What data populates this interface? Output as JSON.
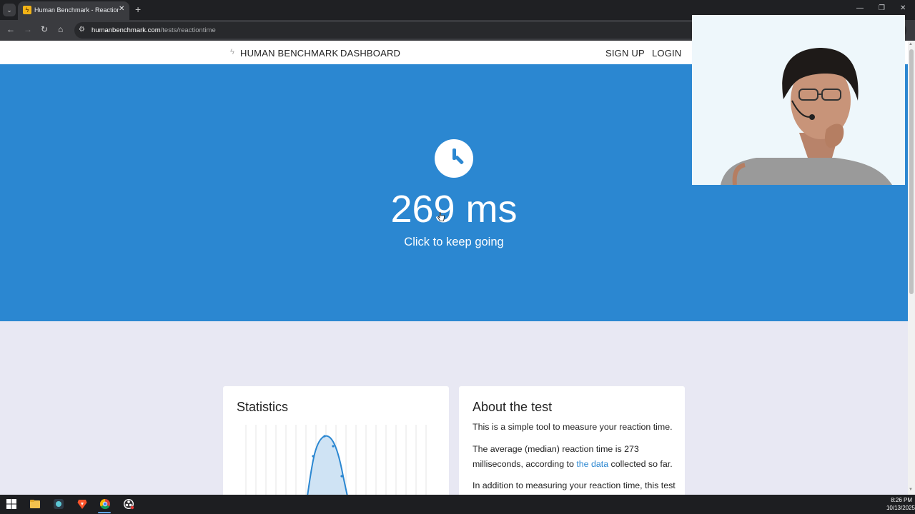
{
  "browser": {
    "tab_title": "Human Benchmark - Reaction Time",
    "tab_favicon": "benchmark-bolt-icon",
    "url_host": "humanbenchmark.com",
    "url_path": "/tests/reactiontime"
  },
  "site_nav": {
    "brand": "HUMAN BENCHMARK",
    "dashboard": "DASHBOARD",
    "sign_up": "SIGN UP",
    "login": "LOGIN"
  },
  "hero": {
    "icon": "clock-icon",
    "result": "269 ms",
    "hint": "Click to keep going"
  },
  "statistics": {
    "title": "Statistics"
  },
  "about": {
    "title": "About the test",
    "p1": "This is a simple tool to measure your reaction time.",
    "p2_before": "The average (median) reaction time is 273 milliseconds, according to ",
    "p2_link": "the data",
    "p2_after": " collected so far.",
    "p3": "In addition to measuring your reaction time, this test"
  },
  "taskbar": {
    "time": "8:26 PM",
    "date": "10/13/2025",
    "icons": [
      "windows-start-icon",
      "file-explorer-icon",
      "photos-icon",
      "brave-browser-icon",
      "chrome-icon",
      "obs-icon"
    ]
  },
  "colors": {
    "hero_blue": "#2b87d1",
    "page_bg": "#e8e8f3",
    "link": "#2b87d1"
  }
}
